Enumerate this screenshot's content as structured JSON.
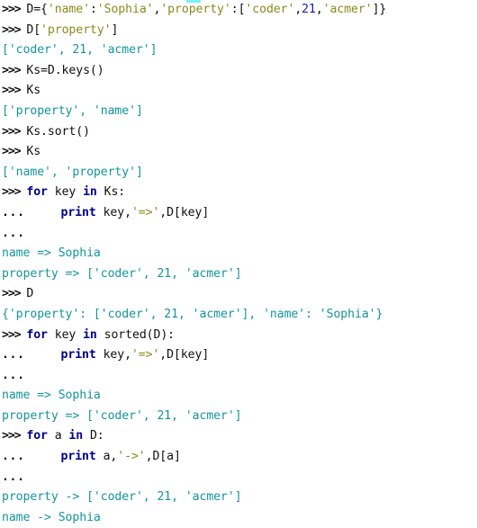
{
  "window": {
    "title": "Python Interactive Console",
    "background_color": "#ffffff"
  },
  "theme": {
    "plain_color": "#101010",
    "prompt_color": "#101010",
    "keyword_color": "#00008f",
    "string_color": "#8a8a1e",
    "number_color": "#1a1ab4",
    "output_color": "#14949c",
    "selection_artifact_color": "#7ff0f5"
  },
  "prompts": {
    "primary": ">>> ",
    "continuation": "... "
  },
  "session": {
    "lines": [
      {
        "id": "line-01",
        "kind": "input",
        "tokens": [
          {
            "t": ">>> ",
            "c": "prompt"
          },
          {
            "t": "D={",
            "c": "plain"
          },
          {
            "t": "'name'",
            "c": "str"
          },
          {
            "t": ":",
            "c": "plain"
          },
          {
            "t": "'Sophia'",
            "c": "str"
          },
          {
            "t": ",",
            "c": "plain"
          },
          {
            "t": "'property'",
            "c": "str"
          },
          {
            "t": ":[",
            "c": "plain"
          },
          {
            "t": "'coder'",
            "c": "str"
          },
          {
            "t": ",",
            "c": "plain"
          },
          {
            "t": "21",
            "c": "num"
          },
          {
            "t": ",",
            "c": "plain"
          },
          {
            "t": "'acmer'",
            "c": "str"
          },
          {
            "t": "]}",
            "c": "plain"
          }
        ]
      },
      {
        "id": "line-02",
        "kind": "input",
        "tokens": [
          {
            "t": ">>> ",
            "c": "prompt"
          },
          {
            "t": "D[",
            "c": "plain"
          },
          {
            "t": "'property'",
            "c": "str"
          },
          {
            "t": "]",
            "c": "plain"
          }
        ]
      },
      {
        "id": "line-03",
        "kind": "output",
        "tokens": [
          {
            "t": "['coder', 21, 'acmer']",
            "c": "out"
          }
        ]
      },
      {
        "id": "line-04",
        "kind": "input",
        "tokens": [
          {
            "t": ">>> ",
            "c": "prompt"
          },
          {
            "t": "Ks=D.keys()",
            "c": "plain"
          }
        ]
      },
      {
        "id": "line-05",
        "kind": "input",
        "tokens": [
          {
            "t": ">>> ",
            "c": "prompt"
          },
          {
            "t": "Ks",
            "c": "plain"
          }
        ]
      },
      {
        "id": "line-06",
        "kind": "output",
        "tokens": [
          {
            "t": "['property', 'name']",
            "c": "out"
          }
        ]
      },
      {
        "id": "line-07",
        "kind": "input",
        "tokens": [
          {
            "t": ">>> ",
            "c": "prompt"
          },
          {
            "t": "Ks.sort()",
            "c": "plain"
          }
        ]
      },
      {
        "id": "line-08",
        "kind": "input",
        "tokens": [
          {
            "t": ">>> ",
            "c": "prompt"
          },
          {
            "t": "Ks",
            "c": "plain"
          }
        ]
      },
      {
        "id": "line-09",
        "kind": "output",
        "tokens": [
          {
            "t": "['name', 'property']",
            "c": "out"
          }
        ]
      },
      {
        "id": "line-10",
        "kind": "input",
        "tokens": [
          {
            "t": ">>> ",
            "c": "prompt"
          },
          {
            "t": "for",
            "c": "kw"
          },
          {
            "t": " key ",
            "c": "plain"
          },
          {
            "t": "in",
            "c": "kw"
          },
          {
            "t": " Ks:",
            "c": "plain"
          }
        ]
      },
      {
        "id": "line-11",
        "kind": "continuation",
        "tokens": [
          {
            "t": "... ",
            "c": "dots"
          },
          {
            "t": "    ",
            "c": "plain"
          },
          {
            "t": "print",
            "c": "kw"
          },
          {
            "t": " key,",
            "c": "plain"
          },
          {
            "t": "'=>'",
            "c": "str"
          },
          {
            "t": ",D[key]",
            "c": "plain"
          }
        ]
      },
      {
        "id": "line-12",
        "kind": "continuation",
        "tokens": [
          {
            "t": "... ",
            "c": "dots"
          }
        ]
      },
      {
        "id": "line-13",
        "kind": "output",
        "tokens": [
          {
            "t": "name => Sophia",
            "c": "out"
          }
        ]
      },
      {
        "id": "line-14",
        "kind": "output",
        "tokens": [
          {
            "t": "property => ['coder', 21, 'acmer']",
            "c": "out"
          }
        ]
      },
      {
        "id": "line-15",
        "kind": "input",
        "tokens": [
          {
            "t": ">>> ",
            "c": "prompt"
          },
          {
            "t": "D",
            "c": "plain"
          }
        ]
      },
      {
        "id": "line-16",
        "kind": "output",
        "tokens": [
          {
            "t": "{'property': ['coder', 21, 'acmer'], 'name': 'Sophia'}",
            "c": "out"
          }
        ]
      },
      {
        "id": "line-17",
        "kind": "input",
        "tokens": [
          {
            "t": ">>> ",
            "c": "prompt"
          },
          {
            "t": "for",
            "c": "kw"
          },
          {
            "t": " key ",
            "c": "plain"
          },
          {
            "t": "in",
            "c": "kw"
          },
          {
            "t": " sorted(D):",
            "c": "plain"
          }
        ]
      },
      {
        "id": "line-18",
        "kind": "continuation",
        "tokens": [
          {
            "t": "... ",
            "c": "dots"
          },
          {
            "t": "    ",
            "c": "plain"
          },
          {
            "t": "print",
            "c": "kw"
          },
          {
            "t": " key,",
            "c": "plain"
          },
          {
            "t": "'=>'",
            "c": "str"
          },
          {
            "t": ",D[key]",
            "c": "plain"
          }
        ]
      },
      {
        "id": "line-19",
        "kind": "continuation",
        "tokens": [
          {
            "t": "... ",
            "c": "dots"
          }
        ]
      },
      {
        "id": "line-20",
        "kind": "output",
        "tokens": [
          {
            "t": "name => Sophia",
            "c": "out"
          }
        ]
      },
      {
        "id": "line-21",
        "kind": "output",
        "tokens": [
          {
            "t": "property => ['coder', 21, 'acmer']",
            "c": "out"
          }
        ]
      },
      {
        "id": "line-22",
        "kind": "input",
        "tokens": [
          {
            "t": ">>> ",
            "c": "prompt"
          },
          {
            "t": "for",
            "c": "kw"
          },
          {
            "t": " a ",
            "c": "plain"
          },
          {
            "t": "in",
            "c": "kw"
          },
          {
            "t": " D:",
            "c": "plain"
          }
        ]
      },
      {
        "id": "line-23",
        "kind": "continuation",
        "tokens": [
          {
            "t": "... ",
            "c": "dots"
          },
          {
            "t": "    ",
            "c": "plain"
          },
          {
            "t": "print",
            "c": "kw"
          },
          {
            "t": " a,",
            "c": "plain"
          },
          {
            "t": "'->'",
            "c": "str"
          },
          {
            "t": ",D[a]",
            "c": "plain"
          }
        ]
      },
      {
        "id": "line-24",
        "kind": "continuation",
        "tokens": [
          {
            "t": "... ",
            "c": "dots"
          }
        ]
      },
      {
        "id": "line-25",
        "kind": "output",
        "tokens": [
          {
            "t": "property -> ['coder', 21, 'acmer']",
            "c": "out"
          }
        ]
      },
      {
        "id": "line-26",
        "kind": "output",
        "tokens": [
          {
            "t": "name -> Sophia",
            "c": "out"
          }
        ]
      }
    ]
  }
}
